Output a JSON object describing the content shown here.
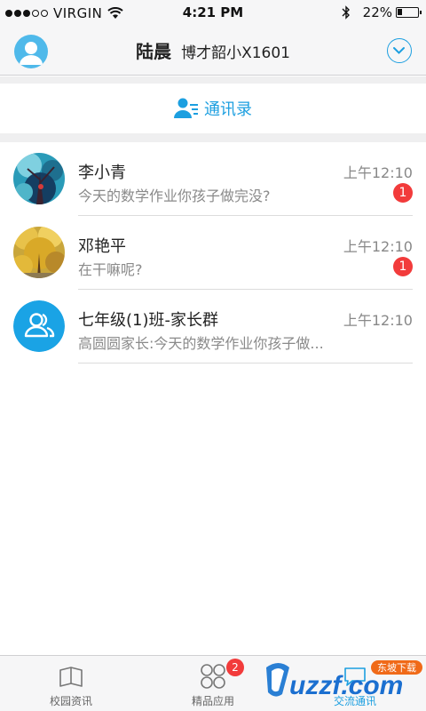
{
  "status_bar": {
    "carrier": "VIRGIN",
    "time": "4:21 PM",
    "battery": "22%",
    "battery_level": 0.22
  },
  "nav": {
    "user_name": "陆晨",
    "school": "博才韶小X1601"
  },
  "contacts": {
    "label": "通讯录"
  },
  "chats": [
    {
      "name": "李小青",
      "time": "上午12:10",
      "preview": "今天的数学作业你孩子做完没?",
      "unread": "1",
      "avatar": "photo-tree-avatar"
    },
    {
      "name": "邓艳平",
      "time": "上午12:10",
      "preview": "在干嘛呢?",
      "unread": "1",
      "avatar": "photo-ginkgo-avatar"
    },
    {
      "name": "七年级(1)班-家长群",
      "time": "上午12:10",
      "preview": "高圆圆家长:今天的数学作业你孩子做...",
      "unread": "",
      "avatar": "group-icon"
    }
  ],
  "tabs": [
    {
      "label": "校园资讯",
      "icon": "book-icon",
      "badge": ""
    },
    {
      "label": "精品应用",
      "icon": "apps-icon",
      "badge": "2"
    },
    {
      "label": "交流通讯",
      "icon": "chat-icon",
      "badge": ""
    }
  ],
  "watermark": {
    "text": "uzzf.com",
    "tag": "东坡下载"
  },
  "colors": {
    "accent": "#1c9fe0",
    "badge": "#f23b3b",
    "bar_bg": "#f6f6f7"
  }
}
